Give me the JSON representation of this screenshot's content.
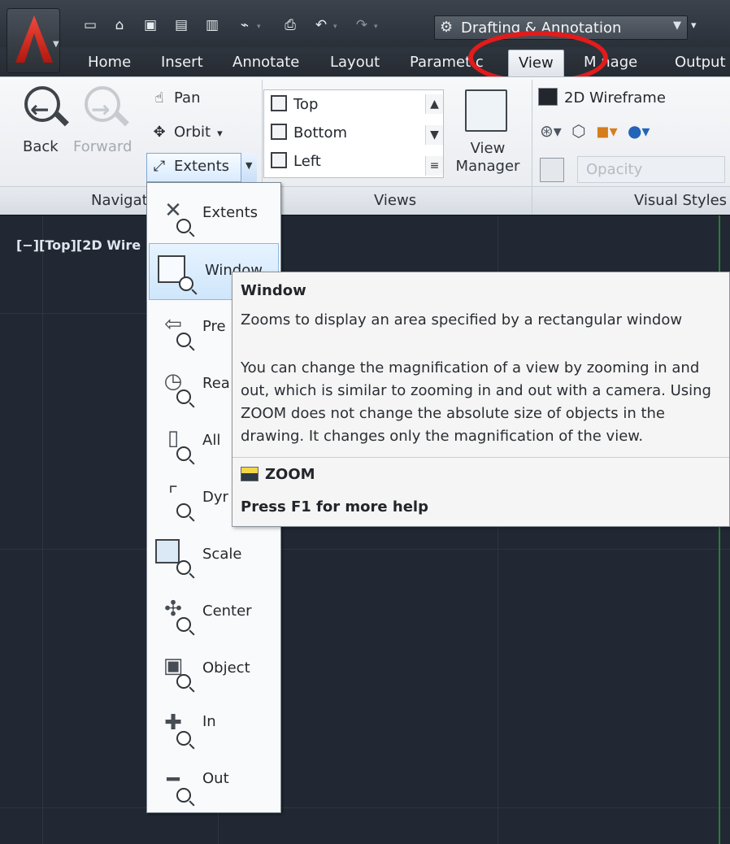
{
  "workspace": {
    "current": "Drafting & Annotation"
  },
  "ribbon_tabs": [
    {
      "label": "Home"
    },
    {
      "label": "Insert"
    },
    {
      "label": "Annotate"
    },
    {
      "label": "Layout"
    },
    {
      "label": "Paramet c"
    },
    {
      "label": "View",
      "active": true
    },
    {
      "label": "M nage"
    },
    {
      "label": "Output"
    }
  ],
  "navigate_panel": {
    "title": "Navigat",
    "back_label": "Back",
    "forward_label": "Forward",
    "pan_label": "Pan",
    "orbit_label": "Orbit",
    "extents_label": "Extents"
  },
  "views_panel": {
    "title": "Views",
    "items": [
      "Top",
      "Bottom",
      "Left"
    ],
    "view_manager_line1": "View",
    "view_manager_line2": "Manager"
  },
  "visual_styles_panel": {
    "title": "Visual Styles",
    "current_style": "2D Wireframe",
    "opacity_placeholder": "Opacity"
  },
  "viewport": {
    "label": "[−][Top][2D Wire"
  },
  "zoom_flyout": {
    "items": [
      {
        "label": "Extents",
        "icon": "zoom-extents-icon"
      },
      {
        "label": "Window",
        "icon": "zoom-window-icon",
        "hover": true
      },
      {
        "label": "Pre",
        "icon": "zoom-previous-icon"
      },
      {
        "label": "Rea",
        "icon": "zoom-realtime-icon"
      },
      {
        "label": "All",
        "icon": "zoom-all-icon"
      },
      {
        "label": "Dyr",
        "icon": "zoom-dynamic-icon"
      },
      {
        "label": "Scale",
        "icon": "zoom-scale-icon"
      },
      {
        "label": "Center",
        "icon": "zoom-center-icon"
      },
      {
        "label": "Object",
        "icon": "zoom-object-icon"
      },
      {
        "label": "In",
        "icon": "zoom-in-icon"
      },
      {
        "label": "Out",
        "icon": "zoom-out-icon"
      }
    ]
  },
  "tooltip": {
    "title": "Window",
    "description": "Zooms to display an area specified by a rectangular window",
    "body_lines": [
      "You can change the magnification of a view by zooming in and",
      "out, which is similar to zooming in and out with a camera. Using",
      "ZOOM does not change the absolute size of objects in the",
      "drawing. It changes only the magnification of the view."
    ],
    "command": "ZOOM",
    "help": "Press F1 for more help"
  },
  "colors": {
    "highlight_ring": "#e21b1b",
    "viewport_bg": "#212833",
    "ribbon_bg": "#f7f8fa"
  }
}
